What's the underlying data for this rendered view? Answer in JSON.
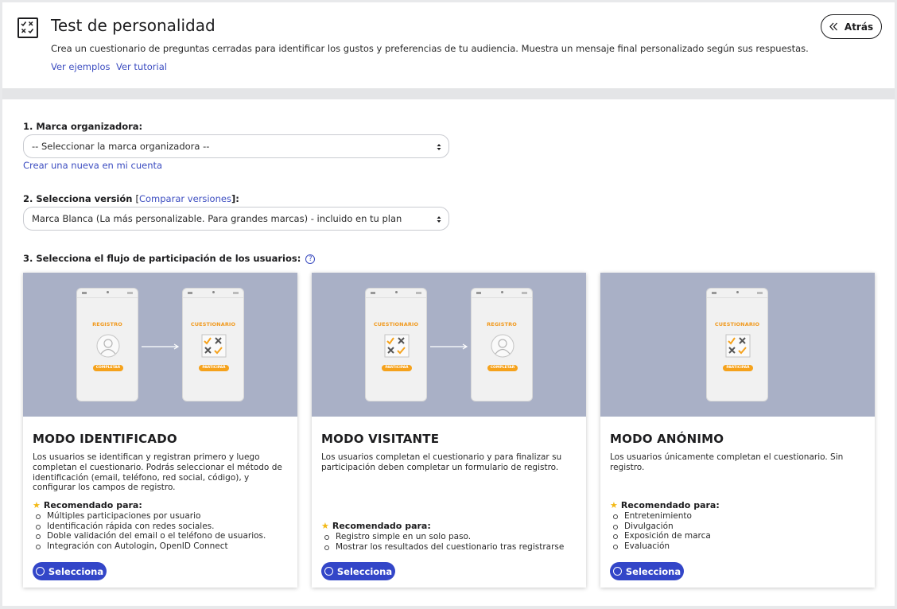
{
  "header": {
    "title": "Test de personalidad",
    "description": "Crea un cuestionario de preguntas cerradas para identificar los gustos y preferencias de tu audiencia. Muestra un mensaje final personalizado según sus respuestas.",
    "examples_link": "Ver ejemplos",
    "tutorial_link": "Ver tutorial",
    "back_label": "Atrás"
  },
  "form": {
    "brand": {
      "label": "1. Marca organizadora:",
      "selected": "-- Seleccionar la marca organizadora --",
      "create_link": "Crear una nueva en mi cuenta"
    },
    "version": {
      "label": "2. Selecciona versión",
      "bracket_open": "[",
      "compare_link": "Comparar versiones",
      "bracket_close": "]:",
      "selected": "Marca Blanca (La más personalizable. Para grandes marcas) - incluido en tu plan"
    },
    "flow": {
      "label": "3. Selecciona el flujo de participación de los usuarios:",
      "help": "?"
    }
  },
  "cards": [
    {
      "title": "MODO IDENTIFICADO",
      "description": "Los usuarios se identifican y registran primero y luego completan el cuestionario. Podrás seleccionar el método de identificación (email, teléfono, red social, código), y configurar los campos de registro.",
      "recommended_label": "Recomendado para:",
      "items": [
        "Múltiples participaciones por usuario",
        "Identificación rápida con redes sociales.",
        "Doble validación del email o el teléfono de usuarios.",
        "Integración con Autologin, OpenID Connect"
      ],
      "button": "Selecciona",
      "phones": [
        {
          "title": "REGISTRO",
          "button": "COMPLETAR"
        },
        {
          "title": "CUESTIONARIO",
          "button": "PARTICIPAR"
        }
      ]
    },
    {
      "title": "MODO VISITANTE",
      "description": "Los usuarios completan el cuestionario y para finalizar su participación deben completar un formulario de registro.",
      "recommended_label": "Recomendado para:",
      "items": [
        "Registro simple en un solo paso.",
        "Mostrar los resultados del cuestionario tras registrarse"
      ],
      "button": "Selecciona",
      "phones": [
        {
          "title": "CUESTIONARIO",
          "button": "PARTICIPAR"
        },
        {
          "title": "REGISTRO",
          "button": "COMPLETAR"
        }
      ]
    },
    {
      "title": "MODO ANÓNIMO",
      "description": "Los usuarios únicamente completan el cuestionario. Sin registro.",
      "recommended_label": "Recomendado para:",
      "items": [
        "Entretenimiento",
        "Divulgación",
        "Exposición de marca",
        "Evaluación"
      ],
      "button": "Selecciona",
      "phones": [
        {
          "title": "CUESTIONARIO",
          "button": "PARTICIPAR"
        }
      ]
    }
  ],
  "colors": {
    "accent": "#3346c8",
    "link": "#3b4cc0",
    "orange": "#f19a1f",
    "illustration_bg": "#a9b0c6"
  },
  "icons": [
    "checklist-icon",
    "double-chevron-left-icon",
    "caret-updown-icon",
    "help-icon",
    "user-avatar-icon",
    "quiz-checks-icon",
    "arrow-right-icon",
    "star-icon",
    "radio-icon"
  ]
}
